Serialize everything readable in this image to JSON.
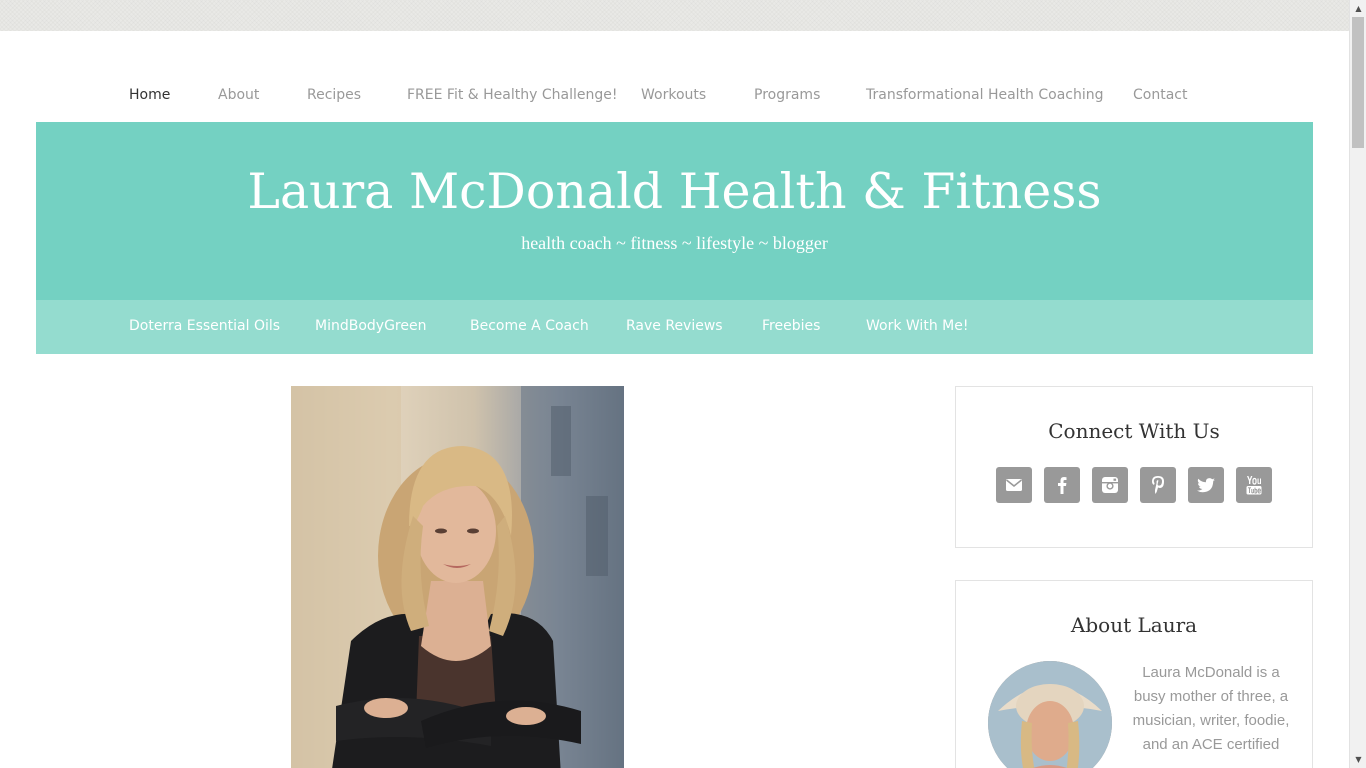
{
  "top_nav": {
    "items": [
      {
        "label": "Home",
        "active": true
      },
      {
        "label": "About"
      },
      {
        "label": "Recipes"
      },
      {
        "label": "FREE Fit & Healthy Challenge!"
      },
      {
        "label": "Workouts"
      },
      {
        "label": "Programs"
      },
      {
        "label": "Transformational Health Coaching"
      },
      {
        "label": "Contact"
      }
    ]
  },
  "header": {
    "title": "Laura McDonald Health & Fitness",
    "tagline": "health coach ~ fitness ~ lifestyle ~ blogger",
    "background_color": "#74d1c2"
  },
  "sub_nav": {
    "background_color": "#94dccf",
    "items": [
      {
        "label": "Doterra Essential Oils"
      },
      {
        "label": "MindBodyGreen"
      },
      {
        "label": "Become A Coach"
      },
      {
        "label": "Rave Reviews"
      },
      {
        "label": "Freebies"
      },
      {
        "label": "Work With Me!"
      }
    ]
  },
  "hero_photo": {
    "icon": "portrait-photo"
  },
  "sidebar": {
    "connect": {
      "title": "Connect With Us",
      "icons": [
        "email-icon",
        "facebook-icon",
        "instagram-icon",
        "pinterest-icon",
        "twitter-icon",
        "youtube-icon"
      ]
    },
    "about": {
      "title": "About Laura",
      "text": "Laura McDonald is a busy mother of three, a musician, writer, foodie, and an ACE certified"
    }
  }
}
